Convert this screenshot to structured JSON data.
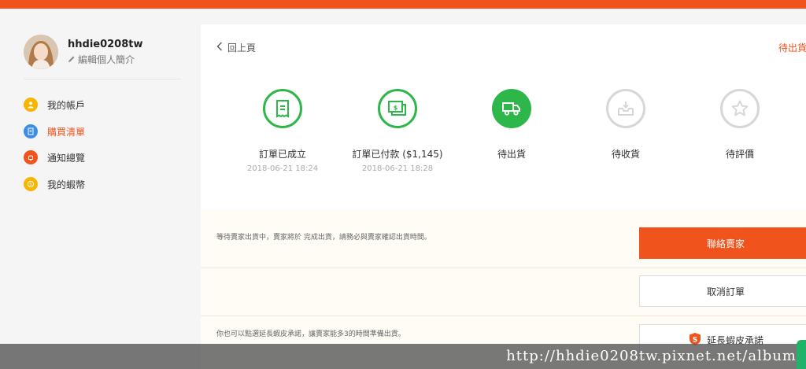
{
  "colors": {
    "accent": "#f0531c",
    "success": "#2db74a",
    "pending": "#d7d7d7"
  },
  "profile": {
    "username": "hhdie0208tw",
    "edit_label": "編輯個人簡介"
  },
  "sidebar": {
    "items": [
      {
        "label": "我的帳戶",
        "icon": "person-icon",
        "color": "#f7b500"
      },
      {
        "label": "購買清單",
        "icon": "list-icon",
        "color": "#3b8ee8"
      },
      {
        "label": "通知總覽",
        "icon": "bell-icon",
        "color": "#f0531c"
      },
      {
        "label": "我的蝦幣",
        "icon": "coin-icon",
        "color": "#f7b500"
      }
    ]
  },
  "order": {
    "back_label": "回上頁",
    "status": "待出貨",
    "steps": [
      {
        "label": "訂單已成立",
        "date": "2018-06-21 18:24",
        "state": "done",
        "icon": "receipt-icon"
      },
      {
        "label": "訂單已付款 ($1,145)",
        "date": "2018-06-21 18:28",
        "state": "done",
        "icon": "payment-icon"
      },
      {
        "label": "待出貨",
        "date": "",
        "state": "current",
        "icon": "truck-icon"
      },
      {
        "label": "待收貨",
        "date": "",
        "state": "todo",
        "icon": "inbox-icon"
      },
      {
        "label": "待評價",
        "date": "",
        "state": "todo",
        "icon": "star-icon"
      }
    ]
  },
  "panel": {
    "note1": "等待賣家出貨中，賣家將於 完成出貨，請務必與賣家確認出貨時間。",
    "note2": "你也可以點選延長蝦皮承諾，讓賣家能多3的時間準備出貨。",
    "contact_seller": "聯絡賣家",
    "cancel_order": "取消訂單",
    "extend_guarantee": "延長蝦皮承諾"
  },
  "watermark": "http://hhdie0208tw.pixnet.net/album"
}
